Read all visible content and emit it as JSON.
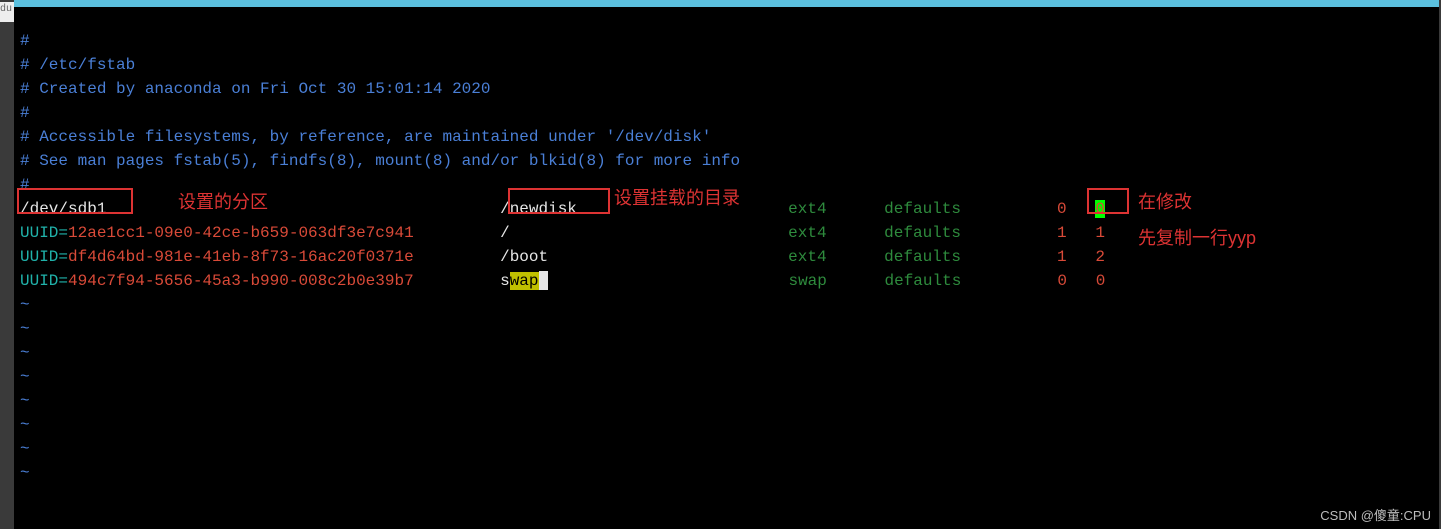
{
  "left_tab": "du",
  "comments": [
    "#",
    "# /etc/fstab",
    "# Created by anaconda on Fri Oct 30 15:01:14 2020",
    "#",
    "# Accessible filesystems, by reference, are maintained under '/dev/disk'",
    "# See man pages fstab(5), findfs(8), mount(8) and/or blkid(8) for more info",
    "#"
  ],
  "rows": [
    {
      "device_label": "/dev/sdb1",
      "device_prefix": "",
      "device_value": "",
      "mount": "/newdisk",
      "fs": "ext4",
      "opts": "defaults",
      "d1": "0",
      "d2": "0",
      "d2_cursor": true
    },
    {
      "device_label": "",
      "device_prefix": "UUID=",
      "device_value": "12ae1cc1-09e0-42ce-b659-063df3e7c941",
      "mount": "/",
      "fs": "ext4",
      "opts": "defaults",
      "d1": "1",
      "d2": "1"
    },
    {
      "device_label": "",
      "device_prefix": "UUID=",
      "device_value": "df4d64bd-981e-41eb-8f73-16ac20f0371e",
      "mount": "/boot",
      "fs": "ext4",
      "opts": "defaults",
      "d1": "1",
      "d2": "2"
    },
    {
      "device_label": "",
      "device_prefix": "UUID=",
      "device_value": "494c7f94-5656-45a3-b990-008c2b0e39b7",
      "mount": "swap",
      "fs": "swap",
      "opts": "defaults",
      "d1": "0",
      "d2": "0",
      "mount_hl": true,
      "trailing_cursor": true
    }
  ],
  "annotations": {
    "a1": "设置的分区",
    "a2": "设置挂载的目录",
    "a3": "在修改",
    "a4": "先复制一行yyp"
  },
  "tilde": "~",
  "watermark": "CSDN @傻童:CPU"
}
